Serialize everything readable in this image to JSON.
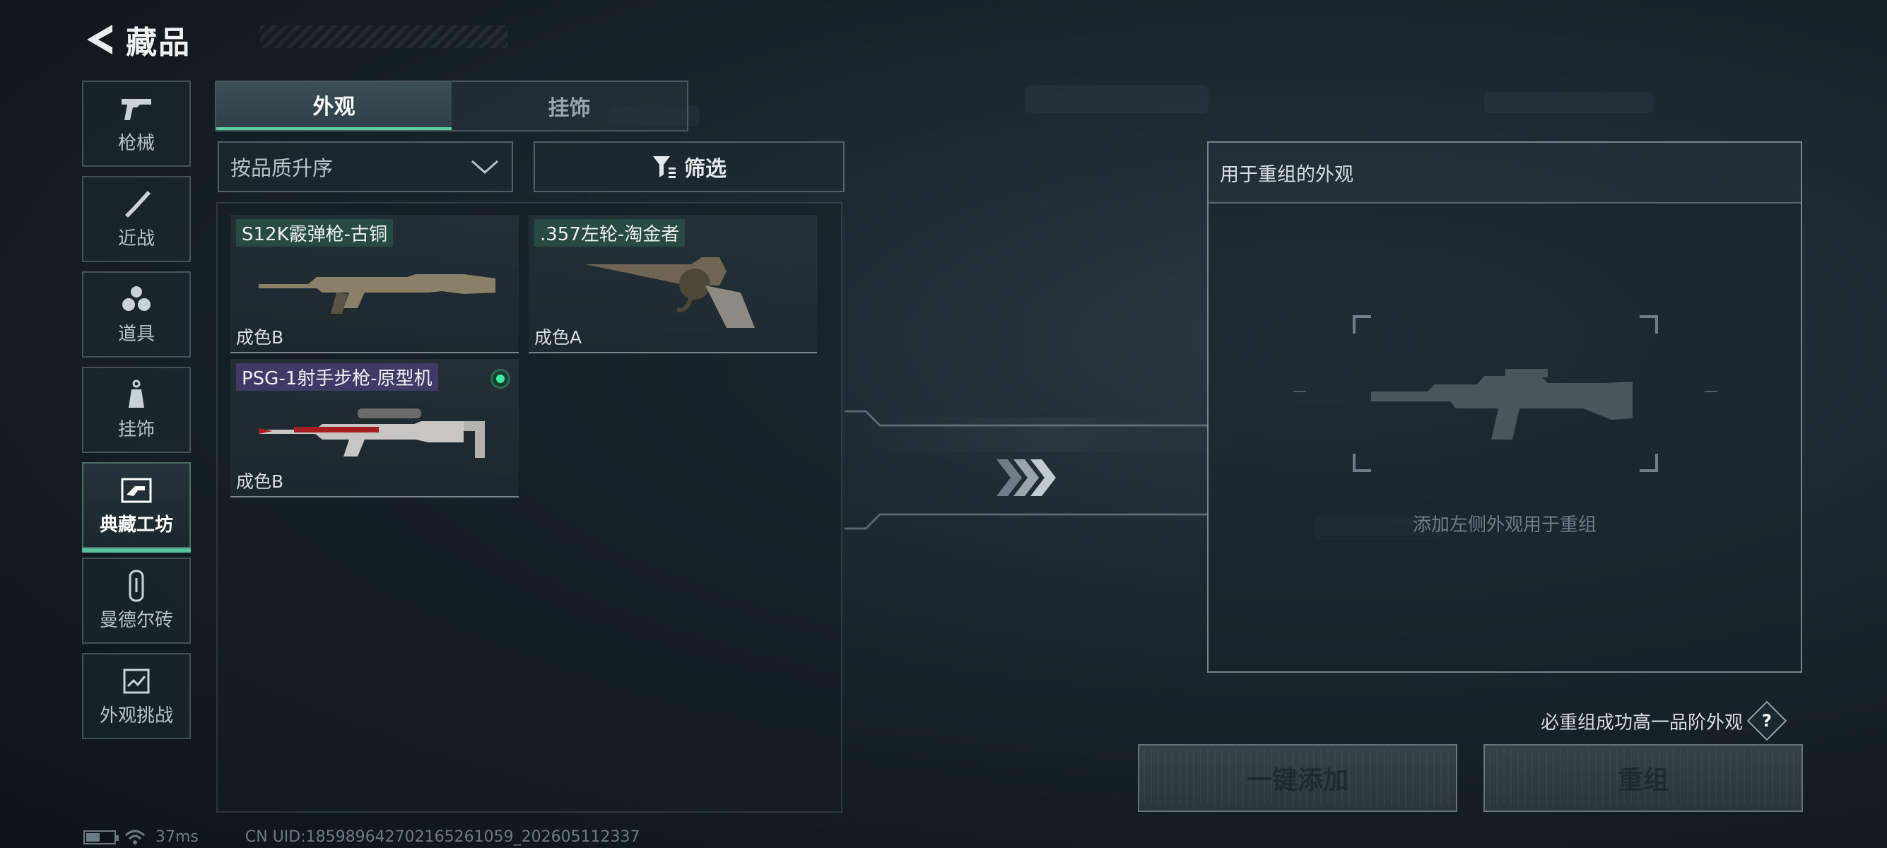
{
  "header": {
    "title": "藏品"
  },
  "sidebar": {
    "items": [
      {
        "label": "枪械",
        "icon": "pistol-icon"
      },
      {
        "label": "近战",
        "icon": "knife-icon"
      },
      {
        "label": "道具",
        "icon": "grenades-icon"
      },
      {
        "label": "挂饰",
        "icon": "charm-icon"
      },
      {
        "label": "典藏工坊",
        "icon": "workshop-icon",
        "active": true
      },
      {
        "label": "曼德尔砖",
        "icon": "brick-icon"
      },
      {
        "label": "外观挑战",
        "icon": "challenge-icon"
      }
    ]
  },
  "tabs": [
    {
      "label": "外观",
      "active": true
    },
    {
      "label": "挂饰",
      "active": false
    }
  ],
  "sort": {
    "label": "按品质升序"
  },
  "filter": {
    "label": "筛选"
  },
  "inventory": [
    {
      "name": "S12K霰弹枪-古铜",
      "grade": "成色B",
      "name_color": "green",
      "icon": "shotgun-icon"
    },
    {
      "name": ".357左轮-淘金者",
      "grade": "成色A",
      "name_color": "green",
      "icon": "revolver-icon"
    },
    {
      "name": "PSG-1射手步枪-原型机",
      "grade": "成色B",
      "name_color": "purple",
      "icon": "sniper-rifle-icon",
      "selected": true
    }
  ],
  "recombine": {
    "header": "用于重组的外观",
    "hint": "添加左侧外观用于重组",
    "placeholder_icon": "assault-rifle-icon"
  },
  "guarantee_text": "必重组成功高一品阶外观",
  "buttons": {
    "add_all": "一键添加",
    "recombine": "重组"
  },
  "status": {
    "ping": "37ms",
    "uid": "CN UID:1859896427021652610​59_202605112337",
    "battery_level": 0.5
  },
  "colors": {
    "accent": "#5ad0a2",
    "selected_dot": "#3cf0a0"
  }
}
